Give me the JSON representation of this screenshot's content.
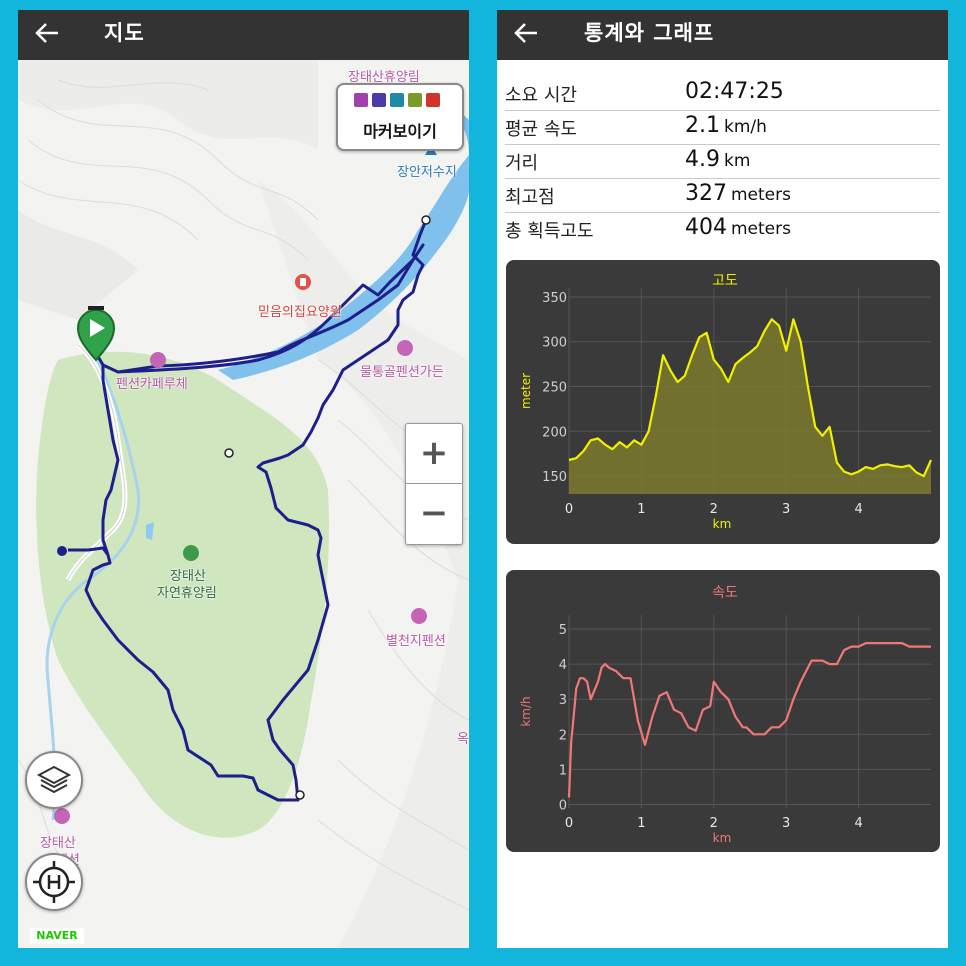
{
  "map_screen": {
    "title": "지도",
    "marker_toggle_label": "마커보이기",
    "marker_icons": [
      {
        "icon": "camera-icon",
        "color": "#a43fb0"
      },
      {
        "icon": "video-icon",
        "color": "#4b3ba8"
      },
      {
        "icon": "pin-icon",
        "color": "#1f8aa8"
      },
      {
        "icon": "note-icon",
        "color": "#7a9a2a"
      },
      {
        "icon": "flag-icon",
        "color": "#d0352a"
      }
    ],
    "places": {
      "top_cut": "장태산휴양림",
      "reservoir": "장안저수지",
      "hospital": "믿음의집요양원",
      "cafe": "펜션카페루체",
      "pension_garden": "물통골펜션가든",
      "forest_line1": "장태산",
      "forest_line2": "자연휴양림",
      "pension_byeolcheon": "별천지펜션",
      "pension_bottom_line1": "장태산",
      "pension_bottom_line2": "휴펜션",
      "edge_cut": "옥"
    },
    "zoom_in_label": "+",
    "zoom_out_label": "−",
    "provider_badge": "NAVER"
  },
  "stats_screen": {
    "title": "통계와 그래프",
    "rows": [
      {
        "label": "소요 시간",
        "value": "02:47:25",
        "unit": ""
      },
      {
        "label": "평균 속도",
        "value": "2.1",
        "unit": "km/h"
      },
      {
        "label": "거리",
        "value": "4.9",
        "unit": "km"
      },
      {
        "label": "최고점",
        "value": "327",
        "unit": "meters"
      },
      {
        "label": "총 획득고도",
        "value": "404",
        "unit": "meters"
      }
    ]
  },
  "chart_data": [
    {
      "type": "area",
      "title": "고도",
      "xlabel": "km",
      "ylabel": "meter",
      "color": "#f0f000",
      "xlim": [
        0,
        5
      ],
      "ylim": [
        130,
        360
      ],
      "yticks": [
        150,
        200,
        250,
        300,
        350
      ],
      "xticks": [
        0,
        1,
        2,
        3,
        4
      ],
      "series": [
        {
          "x": [
            0,
            0.1,
            0.2,
            0.3,
            0.4,
            0.5,
            0.6,
            0.7,
            0.8,
            0.9,
            1.0,
            1.1,
            1.2,
            1.3,
            1.4,
            1.5,
            1.6,
            1.7,
            1.8,
            1.9,
            2.0,
            2.1,
            2.2,
            2.3,
            2.4,
            2.5,
            2.6,
            2.7,
            2.8,
            2.9,
            3.0,
            3.1,
            3.2,
            3.3,
            3.4,
            3.5,
            3.6,
            3.7,
            3.8,
            3.9,
            4.0,
            4.1,
            4.2,
            4.3,
            4.4,
            4.5,
            4.6,
            4.7,
            4.8,
            4.9,
            5.0
          ],
          "values": [
            168,
            170,
            178,
            190,
            192,
            185,
            180,
            188,
            182,
            190,
            185,
            200,
            240,
            285,
            268,
            255,
            262,
            285,
            305,
            310,
            280,
            270,
            255,
            275,
            282,
            288,
            295,
            312,
            325,
            318,
            290,
            325,
            300,
            250,
            205,
            195,
            205,
            165,
            155,
            152,
            155,
            160,
            158,
            162,
            163,
            161,
            160,
            162,
            154,
            150,
            168
          ]
        }
      ]
    },
    {
      "type": "line",
      "title": "속도",
      "xlabel": "km",
      "ylabel": "km/h",
      "color": "#f07878",
      "xlim": [
        0,
        5
      ],
      "ylim": [
        -0.1,
        5.4
      ],
      "yticks": [
        0,
        1,
        2,
        3,
        4,
        5
      ],
      "xticks": [
        0,
        1,
        2,
        3,
        4
      ],
      "series": [
        {
          "x": [
            0,
            0.03,
            0.06,
            0.1,
            0.15,
            0.2,
            0.25,
            0.3,
            0.4,
            0.45,
            0.5,
            0.55,
            0.65,
            0.75,
            0.85,
            0.95,
            1.05,
            1.15,
            1.25,
            1.35,
            1.45,
            1.55,
            1.65,
            1.75,
            1.85,
            1.95,
            2.0,
            2.1,
            2.2,
            2.3,
            2.4,
            2.45,
            2.55,
            2.7,
            2.8,
            2.9,
            3.0,
            3.1,
            3.2,
            3.35,
            3.5,
            3.6,
            3.7,
            3.8,
            3.9,
            4.0,
            4.1,
            4.2,
            4.3,
            4.4,
            4.5,
            4.6,
            4.7,
            4.8,
            4.9,
            5.0
          ],
          "values": [
            0.2,
            1.8,
            2.4,
            3.3,
            3.6,
            3.6,
            3.5,
            3.0,
            3.5,
            3.9,
            4.0,
            3.9,
            3.8,
            3.6,
            3.6,
            2.4,
            1.7,
            2.5,
            3.1,
            3.2,
            2.7,
            2.6,
            2.2,
            2.1,
            2.7,
            2.8,
            3.5,
            3.2,
            3.0,
            2.5,
            2.2,
            2.2,
            2.0,
            2.0,
            2.2,
            2.2,
            2.4,
            3.0,
            3.5,
            4.1,
            4.1,
            4.0,
            4.0,
            4.4,
            4.5,
            4.5,
            4.6,
            4.6,
            4.6,
            4.6,
            4.6,
            4.6,
            4.5,
            4.5,
            4.5,
            4.5
          ]
        }
      ]
    }
  ]
}
